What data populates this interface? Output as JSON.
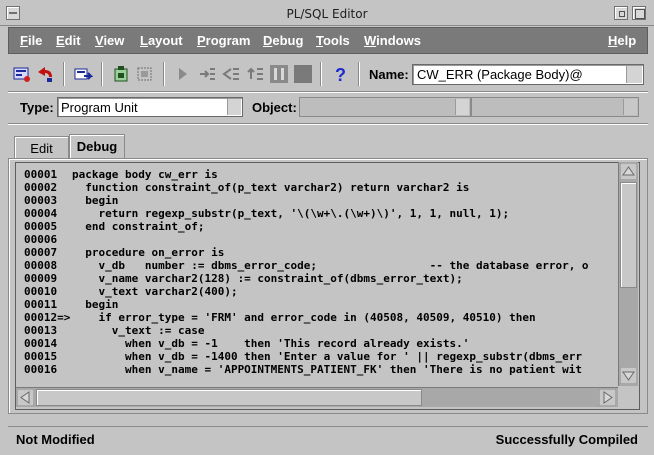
{
  "window": {
    "title": "PL/SQL Editor"
  },
  "menu": [
    {
      "label": "File",
      "ul": "F",
      "rest": "ile"
    },
    {
      "label": "Edit",
      "ul": "E",
      "rest": "dit"
    },
    {
      "label": "View",
      "ul": "V",
      "rest": "iew"
    },
    {
      "label": "Layout",
      "ul": "L",
      "rest": "ayout"
    },
    {
      "label": "Program",
      "ul": "P",
      "rest": "rogram"
    },
    {
      "label": "Debug",
      "ul": "D",
      "rest": "ebug"
    },
    {
      "label": "Tools",
      "ul": "T",
      "rest": "ools"
    },
    {
      "label": "Windows",
      "ul": "W",
      "rest": "indows"
    },
    {
      "label": "Help",
      "ul": "H",
      "rest": "elp"
    }
  ],
  "toolbar": {
    "icons": [
      "compile-icon",
      "revert-icon",
      "new-icon",
      "delete-icon",
      "step-icon",
      "go-icon",
      "step-into-icon",
      "step-over-icon",
      "step-out-icon",
      "pause-icon",
      "stop-icon",
      "help-icon"
    ],
    "name_label": "Name:",
    "name_value": "CW_ERR (Package Body)@"
  },
  "filter": {
    "type_label": "Type:",
    "type_value": "Program Unit",
    "object_label": "Object:"
  },
  "tabs": [
    {
      "label": "Edit",
      "active": false
    },
    {
      "label": "Debug",
      "active": true
    }
  ],
  "code_lines": [
    {
      "ln": "00001",
      "text": "package body cw_err is"
    },
    {
      "ln": "00002",
      "text": "  function constraint_of(p_text varchar2) return varchar2 is"
    },
    {
      "ln": "00003",
      "text": "  begin"
    },
    {
      "ln": "00004",
      "text": "    return regexp_substr(p_text, '\\(\\w+\\.(\\w+)\\)', 1, 1, null, 1);"
    },
    {
      "ln": "00005",
      "text": "  end constraint_of;"
    },
    {
      "ln": "00006",
      "text": ""
    },
    {
      "ln": "00007",
      "text": "  procedure on_error is"
    },
    {
      "ln": "00008",
      "text": "    v_db   number := dbms_error_code;                 -- the database error, o"
    },
    {
      "ln": "00009",
      "text": "    v_name varchar2(128) := constraint_of(dbms_error_text);"
    },
    {
      "ln": "00010",
      "text": "    v_text varchar2(400);"
    },
    {
      "ln": "00011",
      "text": "  begin"
    },
    {
      "ln": "00012=>",
      "text": "    if error_type = 'FRM' and error_code in (40508, 40509, 40510) then"
    },
    {
      "ln": "00013",
      "text": "      v_text := case"
    },
    {
      "ln": "00014",
      "text": "        when v_db = -1    then 'This record already exists.'"
    },
    {
      "ln": "00015",
      "text": "        when v_db = -1400 then 'Enter a value for ' || regexp_substr(dbms_err"
    },
    {
      "ln": "00016",
      "text": "        when v_name = 'APPOINTMENTS_PATIENT_FK' then 'There is no patient wit"
    }
  ],
  "status": {
    "left": "Not Modified",
    "right": "Successfully Compiled"
  }
}
